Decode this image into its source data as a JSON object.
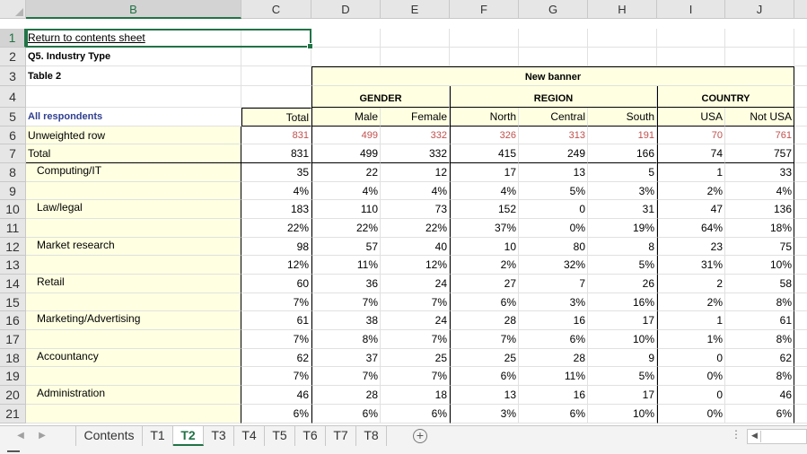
{
  "columns": [
    "B",
    "C",
    "D",
    "E",
    "F",
    "G",
    "H",
    "I",
    "J"
  ],
  "selected_column": "B",
  "rows": [
    "1",
    "2",
    "3",
    "4",
    "5",
    "6",
    "7",
    "8",
    "9",
    "10",
    "11",
    "12",
    "13",
    "14",
    "15",
    "16",
    "17",
    "18",
    "19",
    "20",
    "21"
  ],
  "selected_row": "1",
  "cells": {
    "return_link": "Return to contents sheet",
    "question": "Q5. Industry Type",
    "table_name": "Table 2",
    "banner_title": "New banner",
    "groups": [
      "GENDER",
      "REGION",
      "COUNTRY"
    ],
    "all_respondents": "All respondents",
    "col_headers": [
      "Total",
      "Male",
      "Female",
      "North",
      "Central",
      "South",
      "USA",
      "Not USA"
    ],
    "unweighted_label": "Unweighted row",
    "unweighted_values": [
      "831",
      "499",
      "332",
      "326",
      "313",
      "191",
      "70",
      "761"
    ],
    "total_label": "Total",
    "total_values": [
      "831",
      "499",
      "332",
      "415",
      "249",
      "166",
      "74",
      "757"
    ],
    "categories": [
      {
        "label": "Computing/IT",
        "counts": [
          "35",
          "22",
          "12",
          "17",
          "13",
          "5",
          "1",
          "33"
        ],
        "pcts": [
          "4%",
          "4%",
          "4%",
          "4%",
          "5%",
          "3%",
          "2%",
          "4%"
        ]
      },
      {
        "label": "Law/legal",
        "counts": [
          "183",
          "110",
          "73",
          "152",
          "0",
          "31",
          "47",
          "136"
        ],
        "pcts": [
          "22%",
          "22%",
          "22%",
          "37%",
          "0%",
          "19%",
          "64%",
          "18%"
        ]
      },
      {
        "label": "Market research",
        "counts": [
          "98",
          "57",
          "40",
          "10",
          "80",
          "8",
          "23",
          "75"
        ],
        "pcts": [
          "12%",
          "11%",
          "12%",
          "2%",
          "32%",
          "5%",
          "31%",
          "10%"
        ]
      },
      {
        "label": "Retail",
        "counts": [
          "60",
          "36",
          "24",
          "27",
          "7",
          "26",
          "2",
          "58"
        ],
        "pcts": [
          "7%",
          "7%",
          "7%",
          "6%",
          "3%",
          "16%",
          "2%",
          "8%"
        ]
      },
      {
        "label": "Marketing/Advertising",
        "counts": [
          "61",
          "38",
          "24",
          "28",
          "16",
          "17",
          "1",
          "61"
        ],
        "pcts": [
          "7%",
          "8%",
          "7%",
          "7%",
          "6%",
          "10%",
          "1%",
          "8%"
        ]
      },
      {
        "label": "Accountancy",
        "counts": [
          "62",
          "37",
          "25",
          "25",
          "28",
          "9",
          "0",
          "62"
        ],
        "pcts": [
          "7%",
          "7%",
          "7%",
          "6%",
          "11%",
          "5%",
          "0%",
          "8%"
        ]
      },
      {
        "label": "Administration",
        "counts": [
          "46",
          "28",
          "18",
          "13",
          "16",
          "17",
          "0",
          "46"
        ],
        "pcts": [
          "6%",
          "6%",
          "6%",
          "3%",
          "6%",
          "10%",
          "0%",
          "6%"
        ]
      }
    ]
  },
  "sheet_tabs": [
    "Contents",
    "T1",
    "T2",
    "T3",
    "T4",
    "T5",
    "T6",
    "T7",
    "T8"
  ],
  "active_tab": "T2",
  "colors": {
    "accent": "#217346",
    "yellow_fill": "#ffffe1",
    "unweighted_red": "#c0504d",
    "respondents_blue": "#2f3f8f"
  }
}
